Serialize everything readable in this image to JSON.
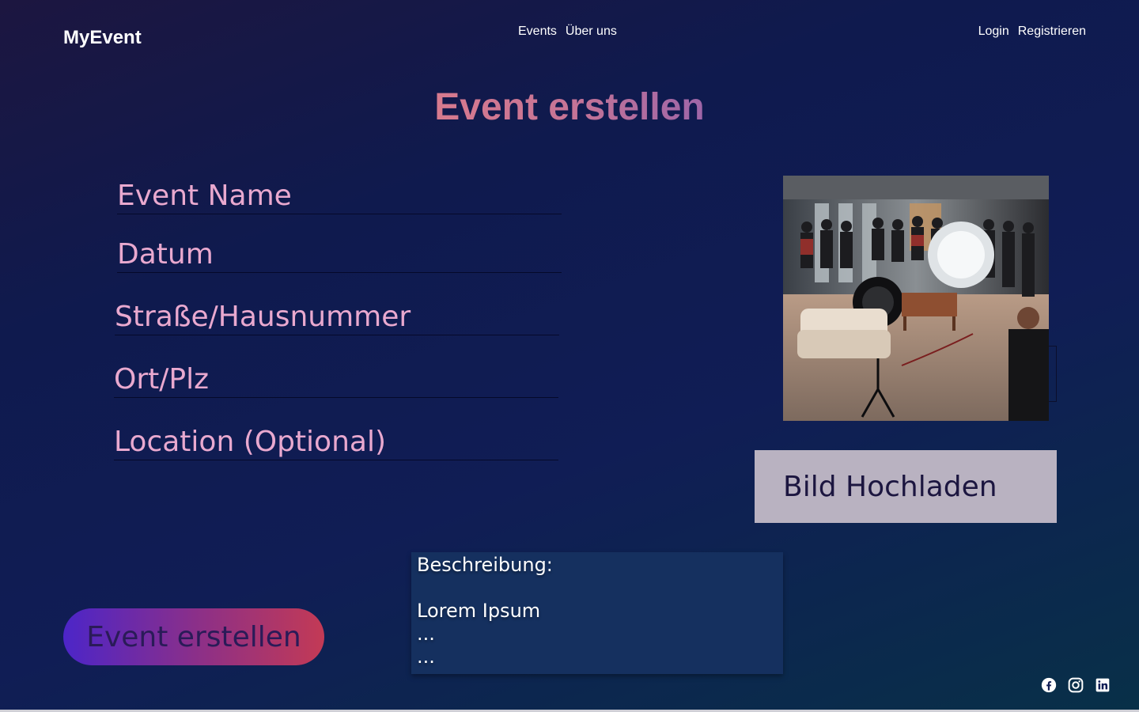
{
  "header": {
    "logo": "MyEvent",
    "nav_center": [
      "Events",
      "Über uns"
    ],
    "nav_right": [
      "Login",
      "Registrieren"
    ]
  },
  "page_title": "Event erstellen",
  "form": {
    "event_name_placeholder": "Event Name",
    "datum_placeholder": "Datum",
    "strasse_placeholder": "Straße/Hausnummer",
    "ort_placeholder": "Ort/Plz",
    "location_placeholder": "Location (Optional)"
  },
  "image": {
    "alt": "Event photo"
  },
  "upload_label": "Bild Hochladen",
  "description": {
    "text": "Beschreibung:\n\nLorem Ipsum\n...\n..."
  },
  "create_button_label": "Event erstellen",
  "social": {
    "icons": [
      "facebook-icon",
      "instagram-icon",
      "linkedin-icon"
    ]
  }
}
